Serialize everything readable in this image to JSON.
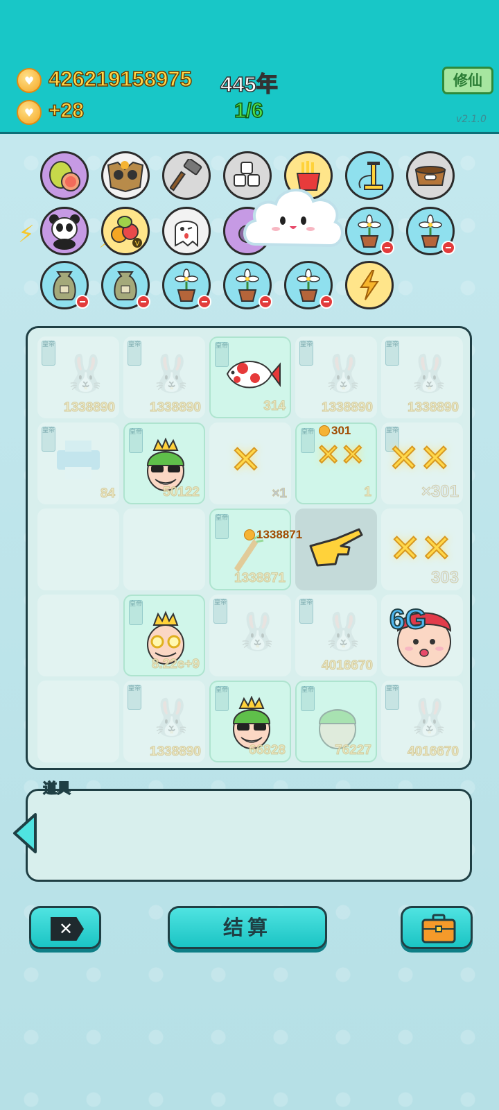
{
  "header": {
    "coins": "426219158975",
    "coin_rate": "+28",
    "years": "445年",
    "progress": "1/6",
    "cultivate_label": "修仙",
    "version": "v2.1.0"
  },
  "items_row1": [
    "pomelo-icon",
    "owl-icon",
    "hammer-icon",
    "sugar-cubes-icon",
    "fries-icon",
    "pump-icon",
    "pet-food-icon"
  ],
  "items_row2": [
    "panda-icon",
    "fruit-bundle-icon",
    "ghost-icon",
    "ghost-purple-icon",
    "flower-pot-icon",
    "flower-pot-icon",
    "flower-pot-icon"
  ],
  "items_row3": [
    "seed-bag-icon",
    "seed-bag-icon",
    "flower-pot-icon",
    "flower-pot-icon",
    "flower-pot-icon",
    "lightning-icon"
  ],
  "board": {
    "tag_text": "皇帝",
    "rows": [
      [
        "1338890",
        "1338890",
        "314",
        "1338890",
        "1338890"
      ],
      [
        "84",
        "50122",
        "×1",
        "1",
        "×301"
      ],
      [
        "",
        "",
        "1338871",
        "",
        "303"
      ],
      [
        "",
        "8.22e+9",
        "",
        "4016670",
        ""
      ],
      [
        "",
        "1338890",
        "66828",
        "76227",
        "4016670"
      ]
    ],
    "pickup_a": "301",
    "pickup_b": "1338871",
    "badge_6g": "6G"
  },
  "tools": {
    "label": "道具"
  },
  "buttons": {
    "settle_label": "结算",
    "close_glyph": "✕"
  }
}
